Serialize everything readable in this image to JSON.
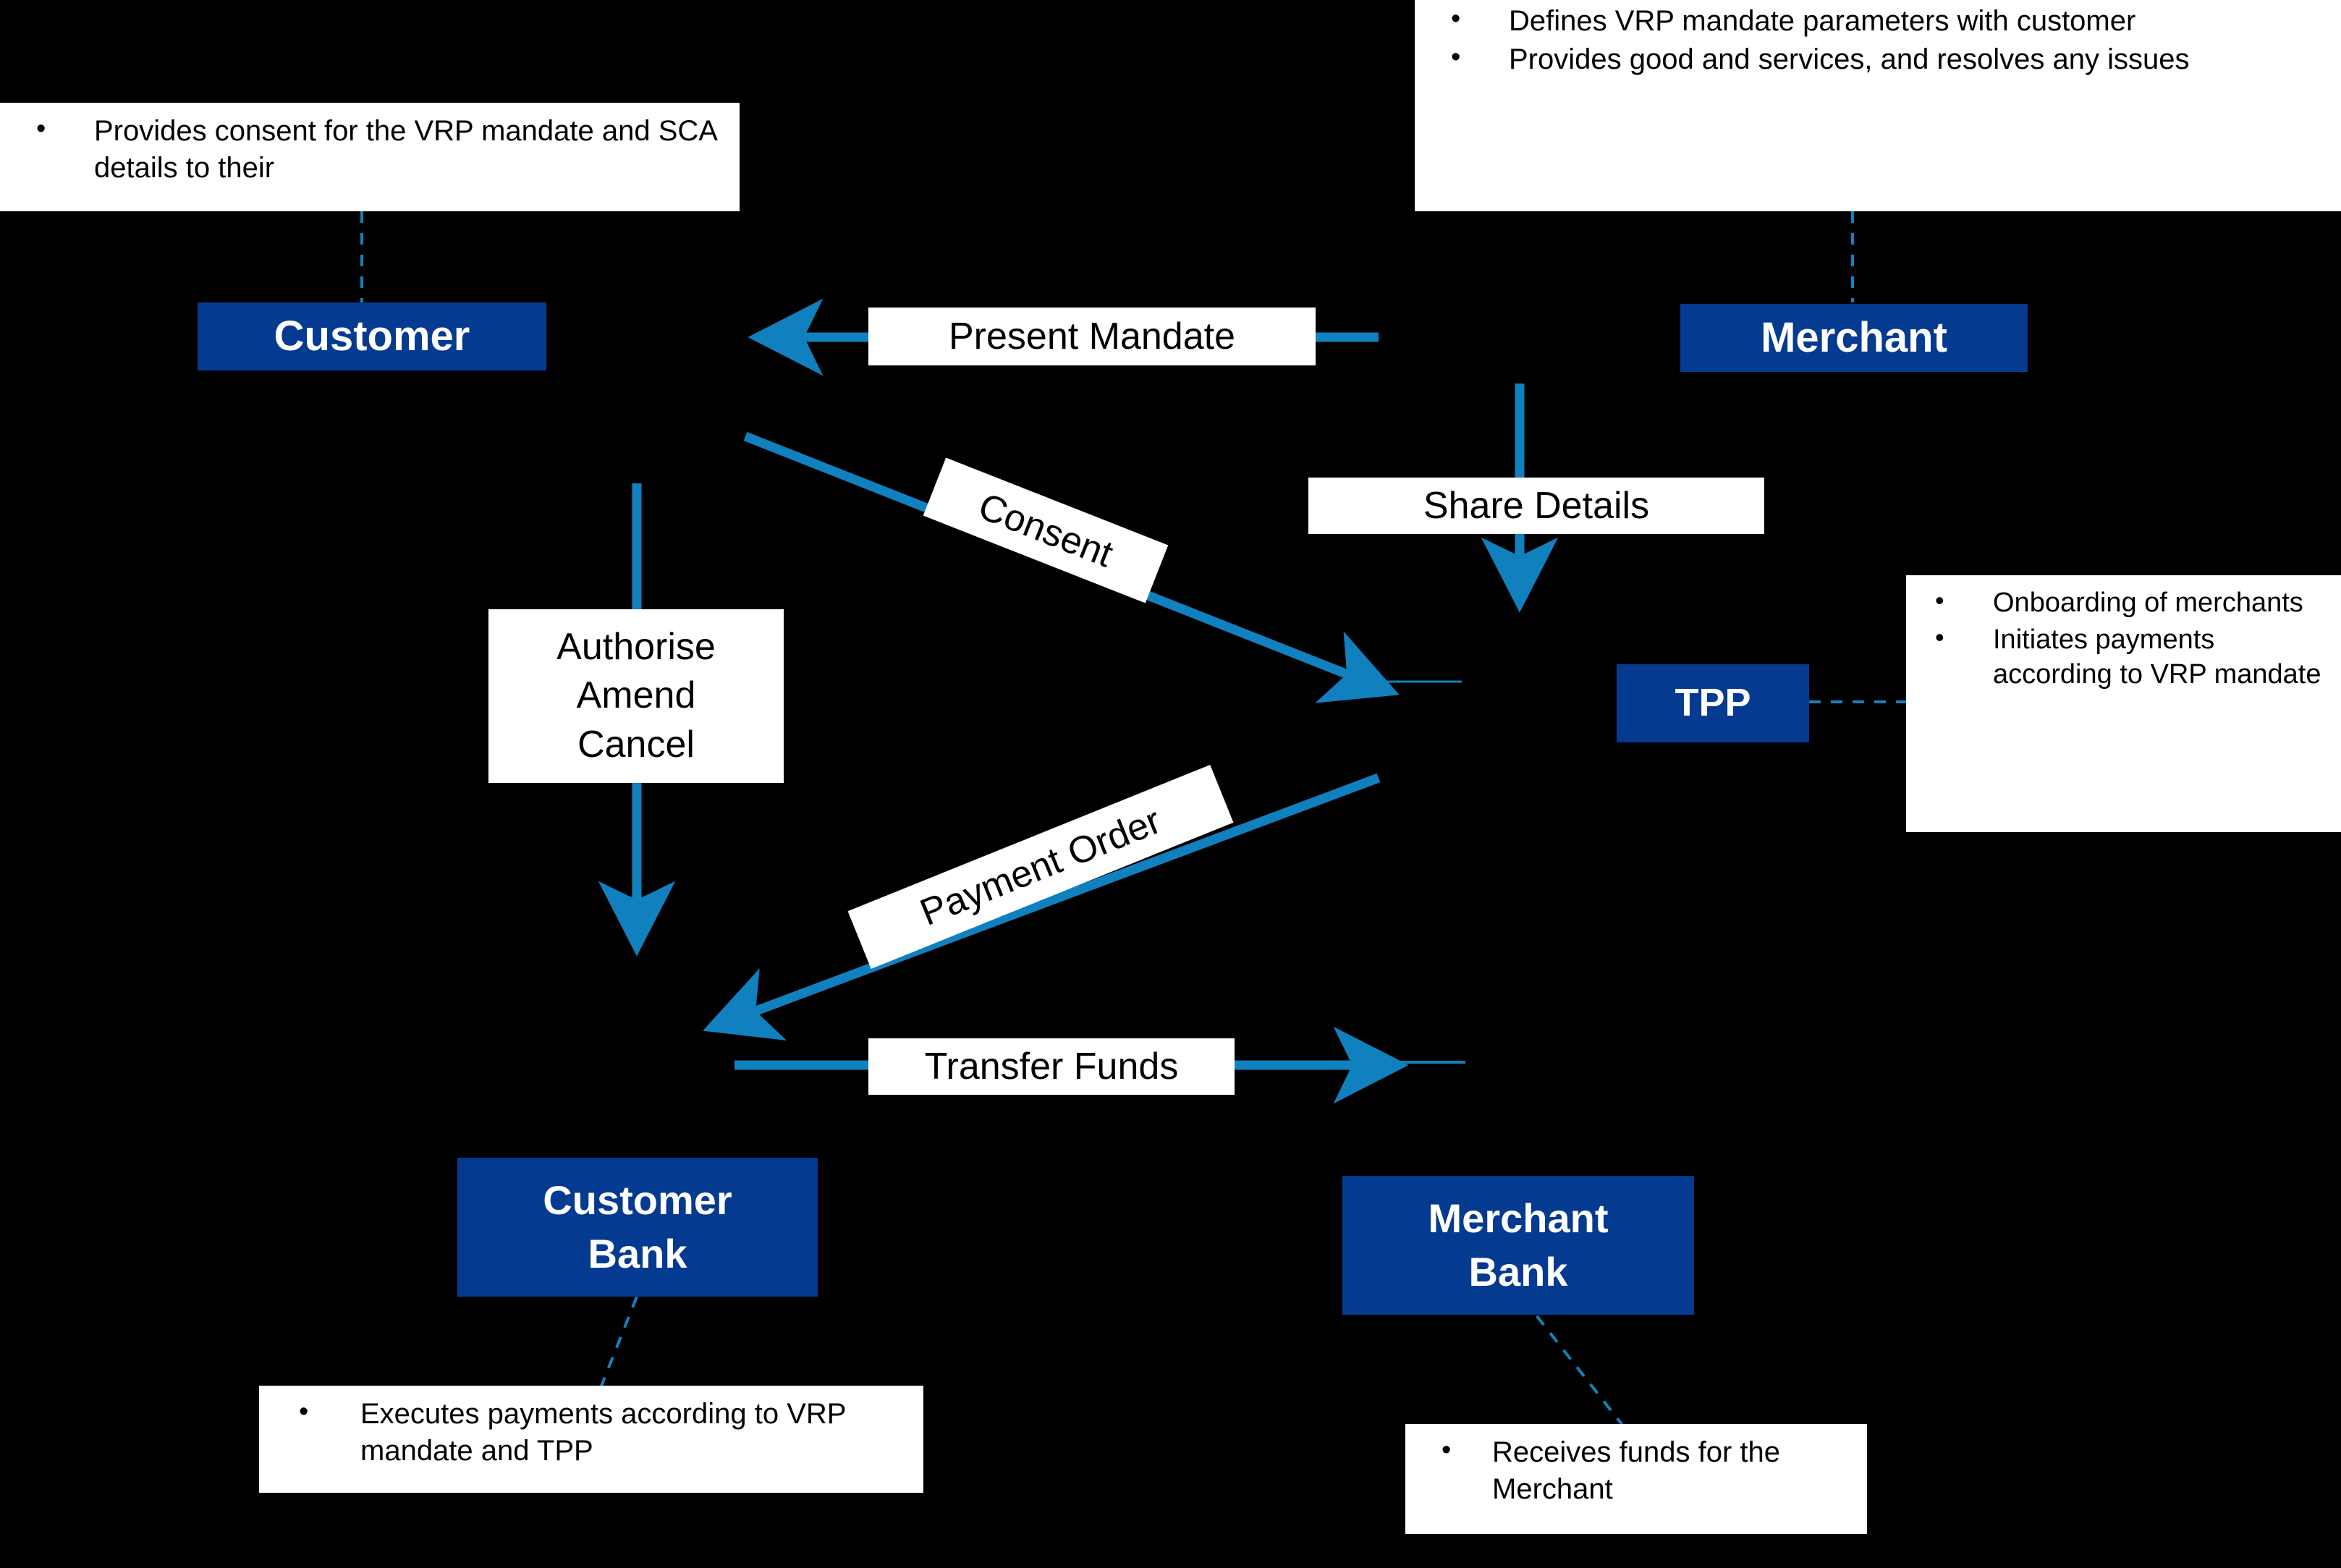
{
  "diagram": {
    "title": "VRP Mandate Payment Flow",
    "colors": {
      "background": "#000000",
      "actor_fill": "#043A8F",
      "actor_text": "#FFFFFF",
      "arrow": "#1180BE",
      "connector_dash": "#1480BD",
      "callout_fill": "#FFFFFF",
      "callout_text": "#000000"
    }
  },
  "actors": [
    {
      "id": "customer",
      "label": "Customer"
    },
    {
      "id": "merchant",
      "label": "Merchant"
    },
    {
      "id": "tpp",
      "label": "TPP"
    },
    {
      "id": "customer_bank",
      "line1": "Customer",
      "line2": "Bank"
    },
    {
      "id": "merchant_bank",
      "line1": "Merchant",
      "line2": "Bank"
    }
  ],
  "callouts": {
    "customer": {
      "items": [
        "Provides consent for the VRP mandate and SCA details to their"
      ]
    },
    "merchant": {
      "items": [
        "Defines VRP mandate parameters with customer",
        "Provides good and services, and resolves any issues"
      ]
    },
    "tpp": {
      "items": [
        "Onboarding of merchants",
        "Initiates payments according to VRP mandate"
      ]
    },
    "customer_bank": {
      "items": [
        "Executes payments according to VRP mandate and TPP"
      ]
    },
    "merchant_bank": {
      "items": [
        "Receives funds for the Merchant"
      ]
    }
  },
  "flows": [
    {
      "id": "present_mandate",
      "label": "Present Mandate"
    },
    {
      "id": "consent",
      "label": "Consent"
    },
    {
      "id": "share_details",
      "label": "Share Details"
    },
    {
      "id": "authorise",
      "line1": "Authorise",
      "line2": "Amend",
      "line3": "Cancel"
    },
    {
      "id": "payment_order",
      "label": "Payment Order"
    },
    {
      "id": "transfer_funds",
      "label": "Transfer Funds"
    }
  ],
  "bullet_glyph": "•"
}
